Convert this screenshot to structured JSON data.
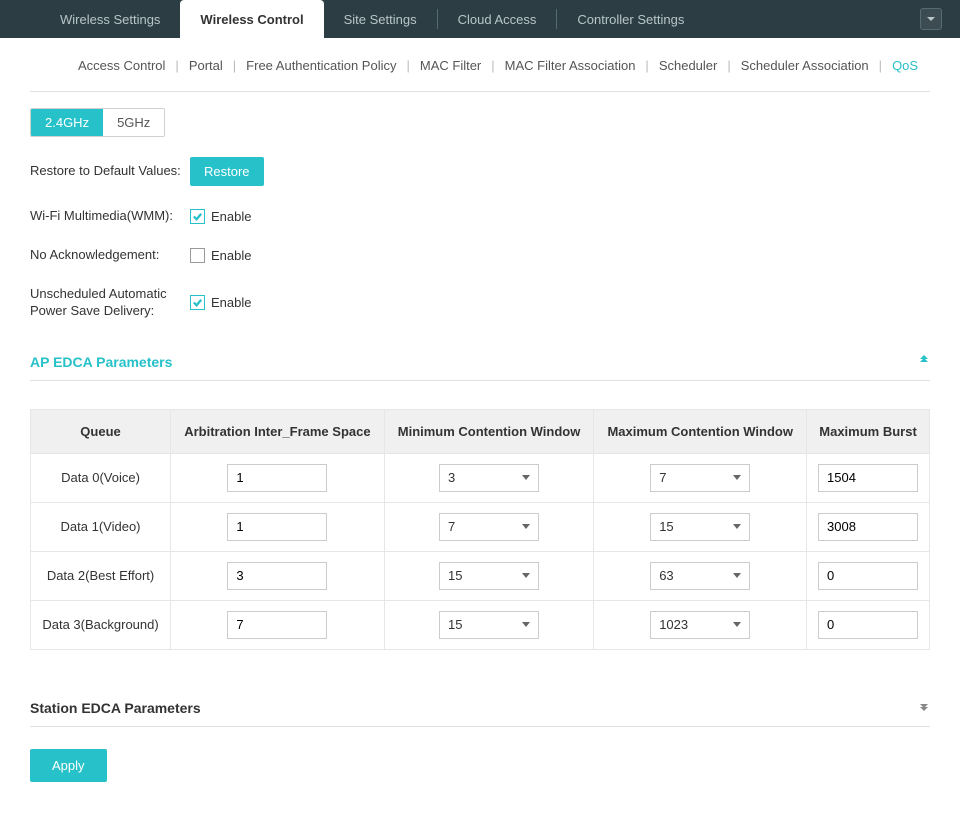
{
  "topNav": {
    "items": [
      {
        "label": "Wireless Settings"
      },
      {
        "label": "Wireless Control"
      },
      {
        "label": "Site Settings"
      },
      {
        "label": "Cloud Access"
      },
      {
        "label": "Controller Settings"
      }
    ]
  },
  "subNav": {
    "items": [
      {
        "label": "Access Control"
      },
      {
        "label": "Portal"
      },
      {
        "label": "Free Authentication Policy"
      },
      {
        "label": "MAC Filter"
      },
      {
        "label": "MAC Filter Association"
      },
      {
        "label": "Scheduler"
      },
      {
        "label": "Scheduler Association"
      },
      {
        "label": "QoS"
      }
    ]
  },
  "band": {
    "b24": "2.4GHz",
    "b5": "5GHz"
  },
  "labels": {
    "restoreDefaults": "Restore to Default Values:",
    "restoreBtn": "Restore",
    "wmm": "Wi-Fi Multimedia(WMM):",
    "noAck": "No Acknowledgement:",
    "uapsd": "Unscheduled Automatic Power Save Delivery:",
    "enable": "Enable",
    "apEdca": "AP EDCA Parameters",
    "stationEdca": "Station EDCA Parameters",
    "apply": "Apply"
  },
  "checks": {
    "wmm": true,
    "noAck": false,
    "uapsd": true
  },
  "table": {
    "headers": {
      "queue": "Queue",
      "aifs": "Arbitration Inter_Frame Space",
      "mincw": "Minimum Contention Window",
      "maxcw": "Maximum Contention Window",
      "burst": "Maximum Burst"
    },
    "rows": [
      {
        "queue": "Data 0(Voice)",
        "aifs": "1",
        "mincw": "3",
        "maxcw": "7",
        "burst": "1504"
      },
      {
        "queue": "Data 1(Video)",
        "aifs": "1",
        "mincw": "7",
        "maxcw": "15",
        "burst": "3008"
      },
      {
        "queue": "Data 2(Best Effort)",
        "aifs": "3",
        "mincw": "15",
        "maxcw": "63",
        "burst": "0"
      },
      {
        "queue": "Data 3(Background)",
        "aifs": "7",
        "mincw": "15",
        "maxcw": "1023",
        "burst": "0"
      }
    ]
  }
}
